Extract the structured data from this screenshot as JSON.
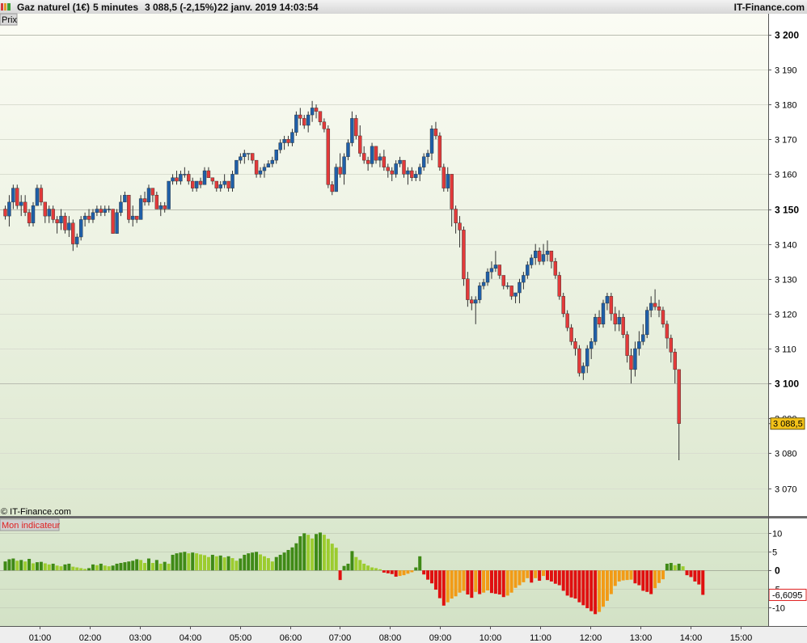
{
  "header": {
    "instrument": "Gaz naturel (1€)",
    "timeframe": "5 minutes",
    "quote": "3 088,5 (-2,15%)",
    "datetime": "22 janv. 2019 14:03:54",
    "brand": "IT-Finance.com"
  },
  "price_panel": {
    "label": "Prix",
    "watermark": "© IT-Finance.com"
  },
  "indicator_panel": {
    "label": "Mon indicateur"
  },
  "colors": {
    "up_candle": "#1f5fa8",
    "down_candle": "#e23a3a",
    "bg_top": "#fbfcf4",
    "bg_bottom": "#d8e6cc"
  },
  "chart_data": [
    {
      "type": "candlestick",
      "title": "Gaz naturel (1€)",
      "ylim": [
        3062,
        3206
      ],
      "y_ticks": [
        {
          "v": 3200,
          "text": "3 200",
          "bold": true
        },
        {
          "v": 3190,
          "text": "3 190"
        },
        {
          "v": 3180,
          "text": "3 180"
        },
        {
          "v": 3170,
          "text": "3 170"
        },
        {
          "v": 3160,
          "text": "3 160"
        },
        {
          "v": 3150,
          "text": "3 150",
          "bold": true
        },
        {
          "v": 3140,
          "text": "3 140"
        },
        {
          "v": 3130,
          "text": "3 130"
        },
        {
          "v": 3120,
          "text": "3 120"
        },
        {
          "v": 3110,
          "text": "3 110"
        },
        {
          "v": 3100,
          "text": "3 100",
          "bold": true
        },
        {
          "v": 3090,
          "text": "3 090"
        },
        {
          "v": 3080,
          "text": "3 080"
        },
        {
          "v": 3070,
          "text": "3 070"
        }
      ],
      "x_ticks": [
        "01:00",
        "02:00",
        "03:00",
        "04:00",
        "05:00",
        "06:00",
        "07:00",
        "08:00",
        "09:00",
        "10:00",
        "11:00",
        "12:00",
        "13:00",
        "14:00",
        "15:00"
      ],
      "last_price": 3088.5,
      "last_price_label": "3 088,5",
      "candles": [
        [
          3150,
          3151,
          3147,
          3148
        ],
        [
          3148,
          3154,
          3145,
          3152
        ],
        [
          3152,
          3157,
          3150,
          3156
        ],
        [
          3156,
          3157,
          3150,
          3151
        ],
        [
          3151,
          3154,
          3148,
          3152
        ],
        [
          3152,
          3154,
          3148,
          3149
        ],
        [
          3149,
          3150,
          3145,
          3146
        ],
        [
          3146,
          3152,
          3145,
          3151
        ],
        [
          3151,
          3157,
          3151,
          3156
        ],
        [
          3156,
          3157,
          3151,
          3152
        ],
        [
          3152,
          3152,
          3146,
          3148
        ],
        [
          3148,
          3151,
          3146,
          3150
        ],
        [
          3150,
          3151,
          3146,
          3147
        ],
        [
          3147,
          3148,
          3143,
          3146
        ],
        [
          3146,
          3150,
          3144,
          3148
        ],
        [
          3148,
          3149,
          3143,
          3144
        ],
        [
          3144,
          3148,
          3142,
          3146
        ],
        [
          3146,
          3147,
          3138,
          3140
        ],
        [
          3140,
          3143,
          3139,
          3142
        ],
        [
          3142,
          3148,
          3141,
          3147
        ],
        [
          3147,
          3149,
          3145,
          3148
        ],
        [
          3148,
          3150,
          3146,
          3147
        ],
        [
          3147,
          3150,
          3146,
          3149
        ],
        [
          3149,
          3151,
          3148,
          3150
        ],
        [
          3150,
          3151,
          3148,
          3149
        ],
        [
          3149,
          3151,
          3148,
          3150
        ],
        [
          3150,
          3151,
          3149,
          3150
        ],
        [
          3150,
          3150,
          3143,
          3143
        ],
        [
          3143,
          3150,
          3143,
          3149
        ],
        [
          3149,
          3154,
          3148,
          3152
        ],
        [
          3152,
          3155,
          3152,
          3154
        ],
        [
          3154,
          3154,
          3146,
          3147
        ],
        [
          3147,
          3151,
          3145,
          3148
        ],
        [
          3148,
          3148,
          3146,
          3147
        ],
        [
          3147,
          3154,
          3147,
          3153
        ],
        [
          3153,
          3155,
          3151,
          3152
        ],
        [
          3152,
          3157,
          3151,
          3156
        ],
        [
          3156,
          3156,
          3152,
          3154
        ],
        [
          3154,
          3155,
          3150,
          3150
        ],
        [
          3150,
          3152,
          3148,
          3151
        ],
        [
          3151,
          3152,
          3149,
          3150
        ],
        [
          3150,
          3158,
          3150,
          3158
        ],
        [
          3158,
          3160,
          3157,
          3159
        ],
        [
          3159,
          3161,
          3157,
          3158
        ],
        [
          3158,
          3161,
          3157,
          3160
        ],
        [
          3160,
          3162,
          3159,
          3160
        ],
        [
          3160,
          3161,
          3157,
          3158
        ],
        [
          3158,
          3159,
          3155,
          3156
        ],
        [
          3156,
          3158,
          3155,
          3158
        ],
        [
          3158,
          3159,
          3156,
          3157
        ],
        [
          3157,
          3162,
          3157,
          3161
        ],
        [
          3161,
          3162,
          3159,
          3159
        ],
        [
          3159,
          3159,
          3157,
          3158
        ],
        [
          3158,
          3158,
          3155,
          3156
        ],
        [
          3156,
          3158,
          3155,
          3157
        ],
        [
          3157,
          3160,
          3156,
          3158
        ],
        [
          3158,
          3158,
          3155,
          3156
        ],
        [
          3156,
          3161,
          3155,
          3160
        ],
        [
          3160,
          3164,
          3160,
          3164
        ],
        [
          3164,
          3166,
          3163,
          3165
        ],
        [
          3165,
          3167,
          3163,
          3166
        ],
        [
          3166,
          3166,
          3164,
          3166
        ],
        [
          3166,
          3165,
          3163,
          3164
        ],
        [
          3164,
          3164,
          3159,
          3160
        ],
        [
          3160,
          3162,
          3159,
          3161
        ],
        [
          3161,
          3163,
          3159,
          3162
        ],
        [
          3162,
          3164,
          3162,
          3163
        ],
        [
          3163,
          3165,
          3162,
          3164
        ],
        [
          3164,
          3167,
          3163,
          3167
        ],
        [
          3167,
          3170,
          3166,
          3169
        ],
        [
          3169,
          3171,
          3167,
          3170
        ],
        [
          3170,
          3171,
          3168,
          3169
        ],
        [
          3169,
          3173,
          3168,
          3172
        ],
        [
          3172,
          3178,
          3171,
          3177
        ],
        [
          3177,
          3179,
          3174,
          3176
        ],
        [
          3176,
          3177,
          3173,
          3174
        ],
        [
          3174,
          3178,
          3172,
          3177
        ],
        [
          3177,
          3181,
          3175,
          3179
        ],
        [
          3179,
          3180,
          3176,
          3178
        ],
        [
          3178,
          3178,
          3174,
          3175
        ],
        [
          3175,
          3176,
          3172,
          3173
        ],
        [
          3173,
          3174,
          3156,
          3157
        ],
        [
          3157,
          3158,
          3154,
          3155
        ],
        [
          3155,
          3163,
          3155,
          3162
        ],
        [
          3162,
          3166,
          3159,
          3160
        ],
        [
          3160,
          3166,
          3157,
          3165
        ],
        [
          3165,
          3170,
          3164,
          3169
        ],
        [
          3169,
          3178,
          3168,
          3176
        ],
        [
          3176,
          3177,
          3170,
          3171
        ],
        [
          3171,
          3174,
          3165,
          3166
        ],
        [
          3166,
          3168,
          3163,
          3164
        ],
        [
          3164,
          3165,
          3161,
          3163
        ],
        [
          3163,
          3169,
          3162,
          3168
        ],
        [
          3168,
          3168,
          3163,
          3164
        ],
        [
          3164,
          3166,
          3162,
          3165
        ],
        [
          3165,
          3167,
          3161,
          3162
        ],
        [
          3162,
          3163,
          3159,
          3161
        ],
        [
          3161,
          3162,
          3158,
          3160
        ],
        [
          3160,
          3164,
          3159,
          3163
        ],
        [
          3163,
          3165,
          3162,
          3164
        ],
        [
          3164,
          3164,
          3159,
          3160
        ],
        [
          3160,
          3162,
          3157,
          3161
        ],
        [
          3161,
          3162,
          3158,
          3159
        ],
        [
          3159,
          3161,
          3158,
          3160
        ],
        [
          3160,
          3163,
          3158,
          3162
        ],
        [
          3162,
          3166,
          3161,
          3165
        ],
        [
          3165,
          3167,
          3163,
          3166
        ],
        [
          3166,
          3174,
          3164,
          3173
        ],
        [
          3173,
          3175,
          3170,
          3171
        ],
        [
          3171,
          3172,
          3161,
          3162
        ],
        [
          3162,
          3163,
          3155,
          3156
        ],
        [
          3156,
          3162,
          3155,
          3160
        ],
        [
          3160,
          3160,
          3145,
          3150
        ],
        [
          3150,
          3151,
          3143,
          3146
        ],
        [
          3146,
          3148,
          3139,
          3144
        ],
        [
          3144,
          3145,
          3128,
          3130
        ],
        [
          3130,
          3132,
          3122,
          3124
        ],
        [
          3124,
          3125,
          3121,
          3123
        ],
        [
          3123,
          3125,
          3117,
          3124
        ],
        [
          3124,
          3129,
          3123,
          3128
        ],
        [
          3128,
          3130,
          3127,
          3129
        ],
        [
          3129,
          3133,
          3128,
          3132
        ],
        [
          3132,
          3135,
          3130,
          3133
        ],
        [
          3133,
          3138,
          3132,
          3134
        ],
        [
          3134,
          3134,
          3130,
          3131
        ],
        [
          3131,
          3131,
          3127,
          3128
        ],
        [
          3128,
          3129,
          3127,
          3128
        ],
        [
          3128,
          3128,
          3124,
          3125
        ],
        [
          3125,
          3126,
          3123,
          3126
        ],
        [
          3126,
          3130,
          3123,
          3129
        ],
        [
          3129,
          3132,
          3127,
          3131
        ],
        [
          3131,
          3135,
          3130,
          3134
        ],
        [
          3134,
          3137,
          3133,
          3136
        ],
        [
          3136,
          3140,
          3134,
          3138
        ],
        [
          3138,
          3139,
          3134,
          3135
        ],
        [
          3135,
          3140,
          3134,
          3137
        ],
        [
          3137,
          3141,
          3135,
          3138
        ],
        [
          3138,
          3138,
          3133,
          3135
        ],
        [
          3135,
          3136,
          3130,
          3131
        ],
        [
          3131,
          3132,
          3124,
          3125
        ],
        [
          3125,
          3126,
          3119,
          3120
        ],
        [
          3120,
          3121,
          3115,
          3116
        ],
        [
          3116,
          3117,
          3111,
          3112
        ],
        [
          3112,
          3113,
          3108,
          3110
        ],
        [
          3110,
          3111,
          3102,
          3103
        ],
        [
          3103,
          3106,
          3101,
          3105
        ],
        [
          3105,
          3111,
          3103,
          3110
        ],
        [
          3110,
          3113,
          3107,
          3112
        ],
        [
          3112,
          3120,
          3111,
          3119
        ],
        [
          3119,
          3121,
          3116,
          3117
        ],
        [
          3117,
          3124,
          3116,
          3123
        ],
        [
          3123,
          3126,
          3121,
          3125
        ],
        [
          3125,
          3126,
          3118,
          3120
        ],
        [
          3120,
          3122,
          3115,
          3117
        ],
        [
          3117,
          3121,
          3115,
          3119
        ],
        [
          3119,
          3120,
          3113,
          3114
        ],
        [
          3114,
          3115,
          3106,
          3108
        ],
        [
          3108,
          3110,
          3100,
          3104
        ],
        [
          3104,
          3112,
          3102,
          3110
        ],
        [
          3110,
          3115,
          3108,
          3112
        ],
        [
          3112,
          3117,
          3111,
          3114
        ],
        [
          3114,
          3122,
          3113,
          3121
        ],
        [
          3121,
          3125,
          3119,
          3123
        ],
        [
          3123,
          3127,
          3121,
          3122
        ],
        [
          3122,
          3124,
          3119,
          3121
        ],
        [
          3121,
          3122,
          3116,
          3117
        ],
        [
          3117,
          3118,
          3110,
          3113
        ],
        [
          3113,
          3114,
          3106,
          3109
        ],
        [
          3109,
          3110,
          3100,
          3104
        ],
        [
          3104,
          3101,
          3078,
          3088.5
        ]
      ],
      "hist_ylim": [
        -15,
        14
      ],
      "hist_ticks": [
        {
          "v": 10,
          "text": "10"
        },
        {
          "v": 5,
          "text": "5"
        },
        {
          "v": 0,
          "text": "0"
        },
        {
          "v": -5,
          "text": "-5"
        },
        {
          "v": -10,
          "text": "-10"
        }
      ],
      "hist_last_label": "-6,6095",
      "hist_values": [
        2.4,
        3.0,
        3.2,
        2.6,
        2.8,
        2.4,
        3.1,
        1.9,
        2.2,
        2.3,
        1.9,
        1.6,
        1.8,
        1.3,
        1.1,
        1.6,
        1.8,
        1.0,
        0.8,
        0.6,
        0.4,
        0.6,
        1.6,
        1.4,
        1.8,
        1.3,
        1.1,
        1.3,
        1.8,
        2.0,
        2.2,
        2.4,
        2.6,
        3.0,
        2.8,
        2.0,
        3.2,
        2.0,
        2.8,
        1.8,
        2.3,
        1.8,
        4.2,
        4.6,
        4.8,
        5.0,
        4.6,
        4.8,
        4.6,
        4.3,
        4.1,
        3.6,
        4.2,
        3.8,
        4.0,
        3.5,
        3.8,
        3.3,
        2.6,
        3.2,
        4.2,
        4.6,
        4.8,
        5.0,
        4.3,
        3.8,
        3.3,
        2.4,
        3.6,
        4.2,
        4.8,
        5.5,
        6.2,
        7.3,
        9.2,
        10.0,
        9.6,
        8.6,
        9.8,
        10.2,
        9.6,
        8.5,
        7.2,
        6.1,
        -2.6,
        1.2,
        1.8,
        5.2,
        3.6,
        2.8,
        1.8,
        1.3,
        0.8,
        0.6,
        0.3,
        -0.6,
        -0.8,
        -1.0,
        -1.7,
        -1.5,
        -1.3,
        -0.9,
        -0.5,
        0.8,
        3.8,
        -1.1,
        -2.5,
        -3.5,
        -5.2,
        -7.5,
        -9.5,
        -8.6,
        -7.6,
        -7.0,
        -6.0,
        -5.5,
        -6.5,
        -7.4,
        -5.8,
        -6.4,
        -6.0,
        -5.4,
        -6.1,
        -6.3,
        -6.5,
        -7.2,
        -6.8,
        -6.0,
        -4.7,
        -4.0,
        -3.2,
        -2.1,
        -3.3,
        -2.1,
        -2.8,
        -1.5,
        -2.6,
        -3.0,
        -3.6,
        -4.0,
        -5.5,
        -6.8,
        -7.3,
        -7.6,
        -8.6,
        -9.4,
        -10.2,
        -11.0,
        -11.8,
        -11.2,
        -9.8,
        -8.2,
        -6.4,
        -4.2,
        -3.0,
        -2.7,
        -2.6,
        -2.5,
        -3.5,
        -4.0,
        -5.5,
        -5.8,
        -6.4,
        -4.8,
        -3.4,
        -2.4,
        1.8,
        2.0,
        1.4,
        1.8,
        1.1,
        -1.3,
        -1.8,
        -3.0,
        -3.8,
        -6.6
      ]
    }
  ]
}
